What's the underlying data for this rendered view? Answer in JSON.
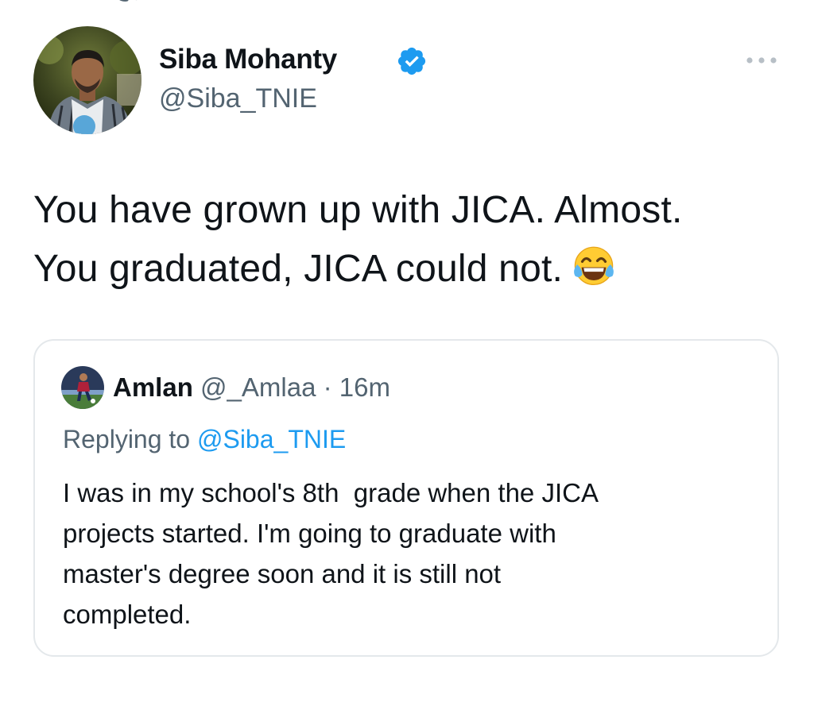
{
  "tweet": {
    "author": {
      "name": "Siba Mohanty",
      "handle": "@Siba_TNIE",
      "verified": true
    },
    "text_lines": [
      "You have grown up with JICA. Almost.",
      "You graduated, JICA could not."
    ],
    "emoji": "face-with-tears-of-joy-icon"
  },
  "quoted_tweet": {
    "author": {
      "name": "Amlan",
      "handle": "@_Amlaa",
      "separator": "·",
      "time": "16m"
    },
    "replying_prefix": "Replying to",
    "replying_to": "@Siba_TNIE",
    "text_lines": [
      "I was in my school's 8th  grade when the JICA",
      "projects started. I'm going to graduate with",
      "master's degree soon and it is still not",
      "completed."
    ]
  },
  "colors": {
    "text": "#0f1419",
    "secondary": "#536471",
    "link": "#1d9bf0",
    "verified": "#1d9bf0",
    "border": "#e4e8eb"
  },
  "icons": {
    "verified": "verified-badge-icon",
    "more": "more-options-icon"
  }
}
